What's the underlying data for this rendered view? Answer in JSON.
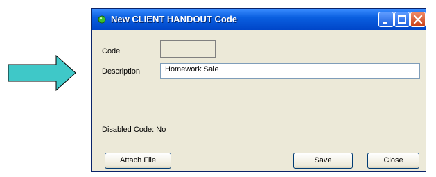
{
  "window": {
    "title": "New CLIENT HANDOUT Code",
    "accent": "#0a5fe0"
  },
  "form": {
    "code_label": "Code",
    "code_value": "",
    "description_label": "Description",
    "description_value": "Homework Sale",
    "disabled_label": "Disabled Code: No"
  },
  "buttons": {
    "attach_file": "Attach File",
    "save": "Save",
    "close": "Close"
  },
  "colors": {
    "arrow_fill": "#3fc8c8",
    "titlebar": "#0a5fe0",
    "window_bg": "#ece9d8"
  }
}
